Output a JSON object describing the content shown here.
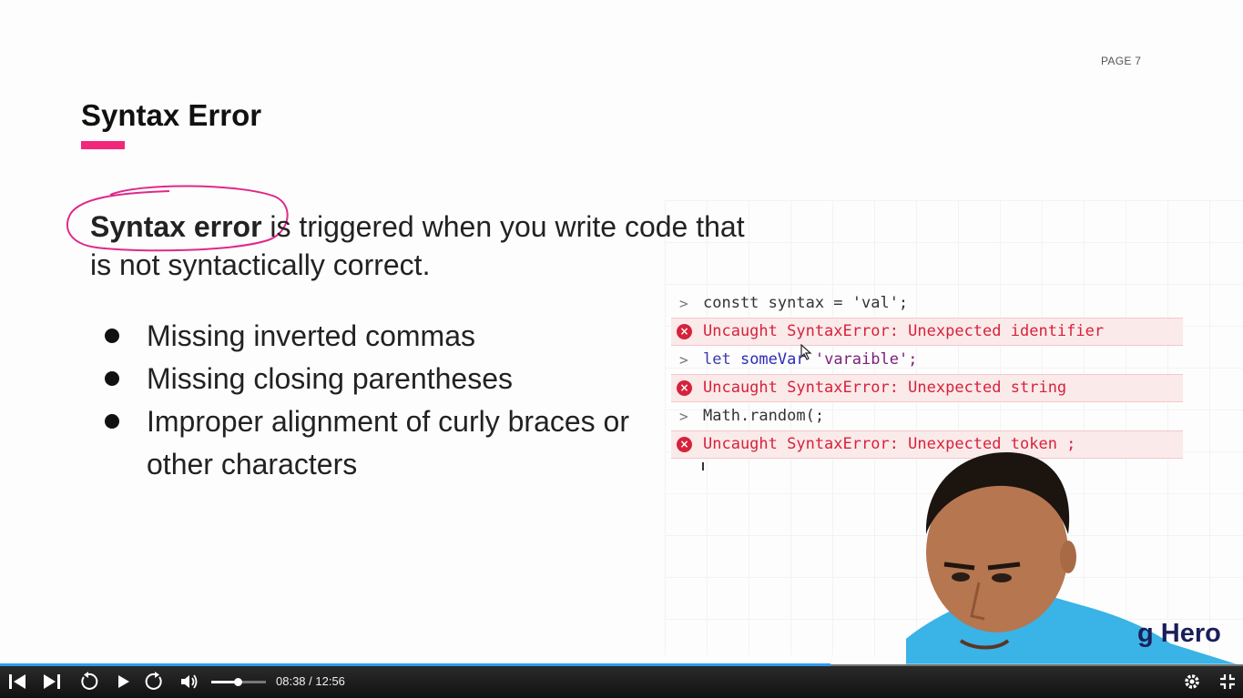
{
  "slide": {
    "page_label": "PAGE 7",
    "title": "Syntax Error",
    "accent_color": "#f2267a",
    "intro_bold": "Syntax error",
    "intro_rest": " is triggered when you write code that is not syntactically correct.",
    "bullets": [
      "Missing inverted commas",
      "Missing closing parentheses",
      "Improper alignment of curly braces or other characters"
    ]
  },
  "console": {
    "lines": [
      {
        "kind": "input",
        "code": "constt syntax = 'val';"
      },
      {
        "kind": "error",
        "code": "Uncaught SyntaxError: Unexpected identifier"
      },
      {
        "kind": "input",
        "code_keyword": "let",
        "code_ident": " someVar",
        "code_string": " 'varaible';"
      },
      {
        "kind": "error",
        "code": "Uncaught SyntaxError: Unexpected string"
      },
      {
        "kind": "input",
        "code": "Math.random(;"
      },
      {
        "kind": "error",
        "code": "Uncaught SyntaxError: Unexpected token ;"
      }
    ],
    "prompt_glyph": ">",
    "error_glyph": "×",
    "error_color": "#d6223b"
  },
  "webcam": {
    "brand_text": "g Hero"
  },
  "player": {
    "time": "08:38 / 12:56",
    "progress_fraction": 0.668,
    "volume_fraction": 0.48,
    "progress_color": "#2d9cf0",
    "icons": [
      "skip-back-icon",
      "skip-forward-icon",
      "replay-icon",
      "play-icon",
      "forward-icon",
      "volume-icon",
      "settings-icon",
      "exit-fullscreen-icon"
    ]
  }
}
